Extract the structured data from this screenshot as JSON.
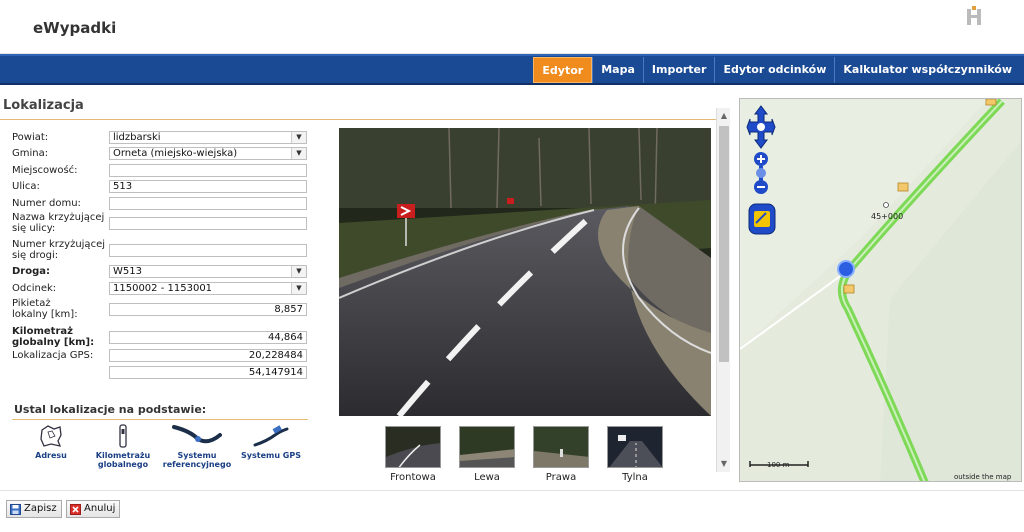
{
  "app": {
    "title": "eWypadki"
  },
  "nav": {
    "tabs": [
      {
        "label": "Edytor",
        "active": true
      },
      {
        "label": "Mapa"
      },
      {
        "label": "Importer"
      },
      {
        "label": "Edytor odcinków"
      },
      {
        "label": "Kalkulator współczynników"
      }
    ]
  },
  "panel": {
    "title": "Lokalizacja"
  },
  "form": {
    "powiat_label": "Powiat:",
    "powiat_value": "lidzbarski",
    "gmina_label": "Gmina:",
    "gmina_value": "Orneta (miejsko-wiejska)",
    "miejscowosc_label": "Miejscowość:",
    "miejscowosc_value": "",
    "ulica_label": "Ulica:",
    "ulica_value": "513",
    "numer_domu_label": "Numer domu:",
    "numer_domu_value": "",
    "krzyz_ulicy_label1": "Nazwa krzyżującej",
    "krzyz_ulicy_label2": "się ulicy:",
    "krzyz_ulicy_value": "",
    "krzyz_drogi_label1": "Numer krzyżującej",
    "krzyz_drogi_label2": "się drogi:",
    "krzyz_drogi_value": "",
    "droga_label": "Droga:",
    "droga_value": "W513",
    "odcinek_label": "Odcinek:",
    "odcinek_value": "1150002 - 1153001",
    "pikietaz_label1": "Pikietaż",
    "pikietaz_label2": "lokalny [km]:",
    "pikietaz_value": "8,857",
    "kilometraz_label1": "Kilometraż",
    "kilometraz_label2": "globalny [km]:",
    "kilometraz_value": "44,864",
    "gps_label": "Lokalizacja GPS:",
    "gps_value1": "20,228484",
    "gps_value2": "54,147914"
  },
  "basis": {
    "title": "Ustal lokalizacje na podstawie:",
    "options": [
      {
        "line1": "Adresu",
        "line2": ""
      },
      {
        "line1": "Kilometrażu",
        "line2": "globalnego"
      },
      {
        "line1": "Systemu",
        "line2": "referencyjnego"
      },
      {
        "line1": "Systemu GPS",
        "line2": ""
      }
    ]
  },
  "thumbnails": [
    "Frontowa",
    "Lewa",
    "Prawa",
    "Tylna"
  ],
  "map": {
    "chainage_label": "45+000",
    "scale_label": "100 m",
    "attribution": "outside the map"
  },
  "buttons": {
    "save": "Zapisz",
    "cancel": "Anuluj"
  },
  "colors": {
    "nav_bg": "#1a4a94",
    "tab_active": "#f08c1e",
    "road_green": "#7ed957"
  }
}
